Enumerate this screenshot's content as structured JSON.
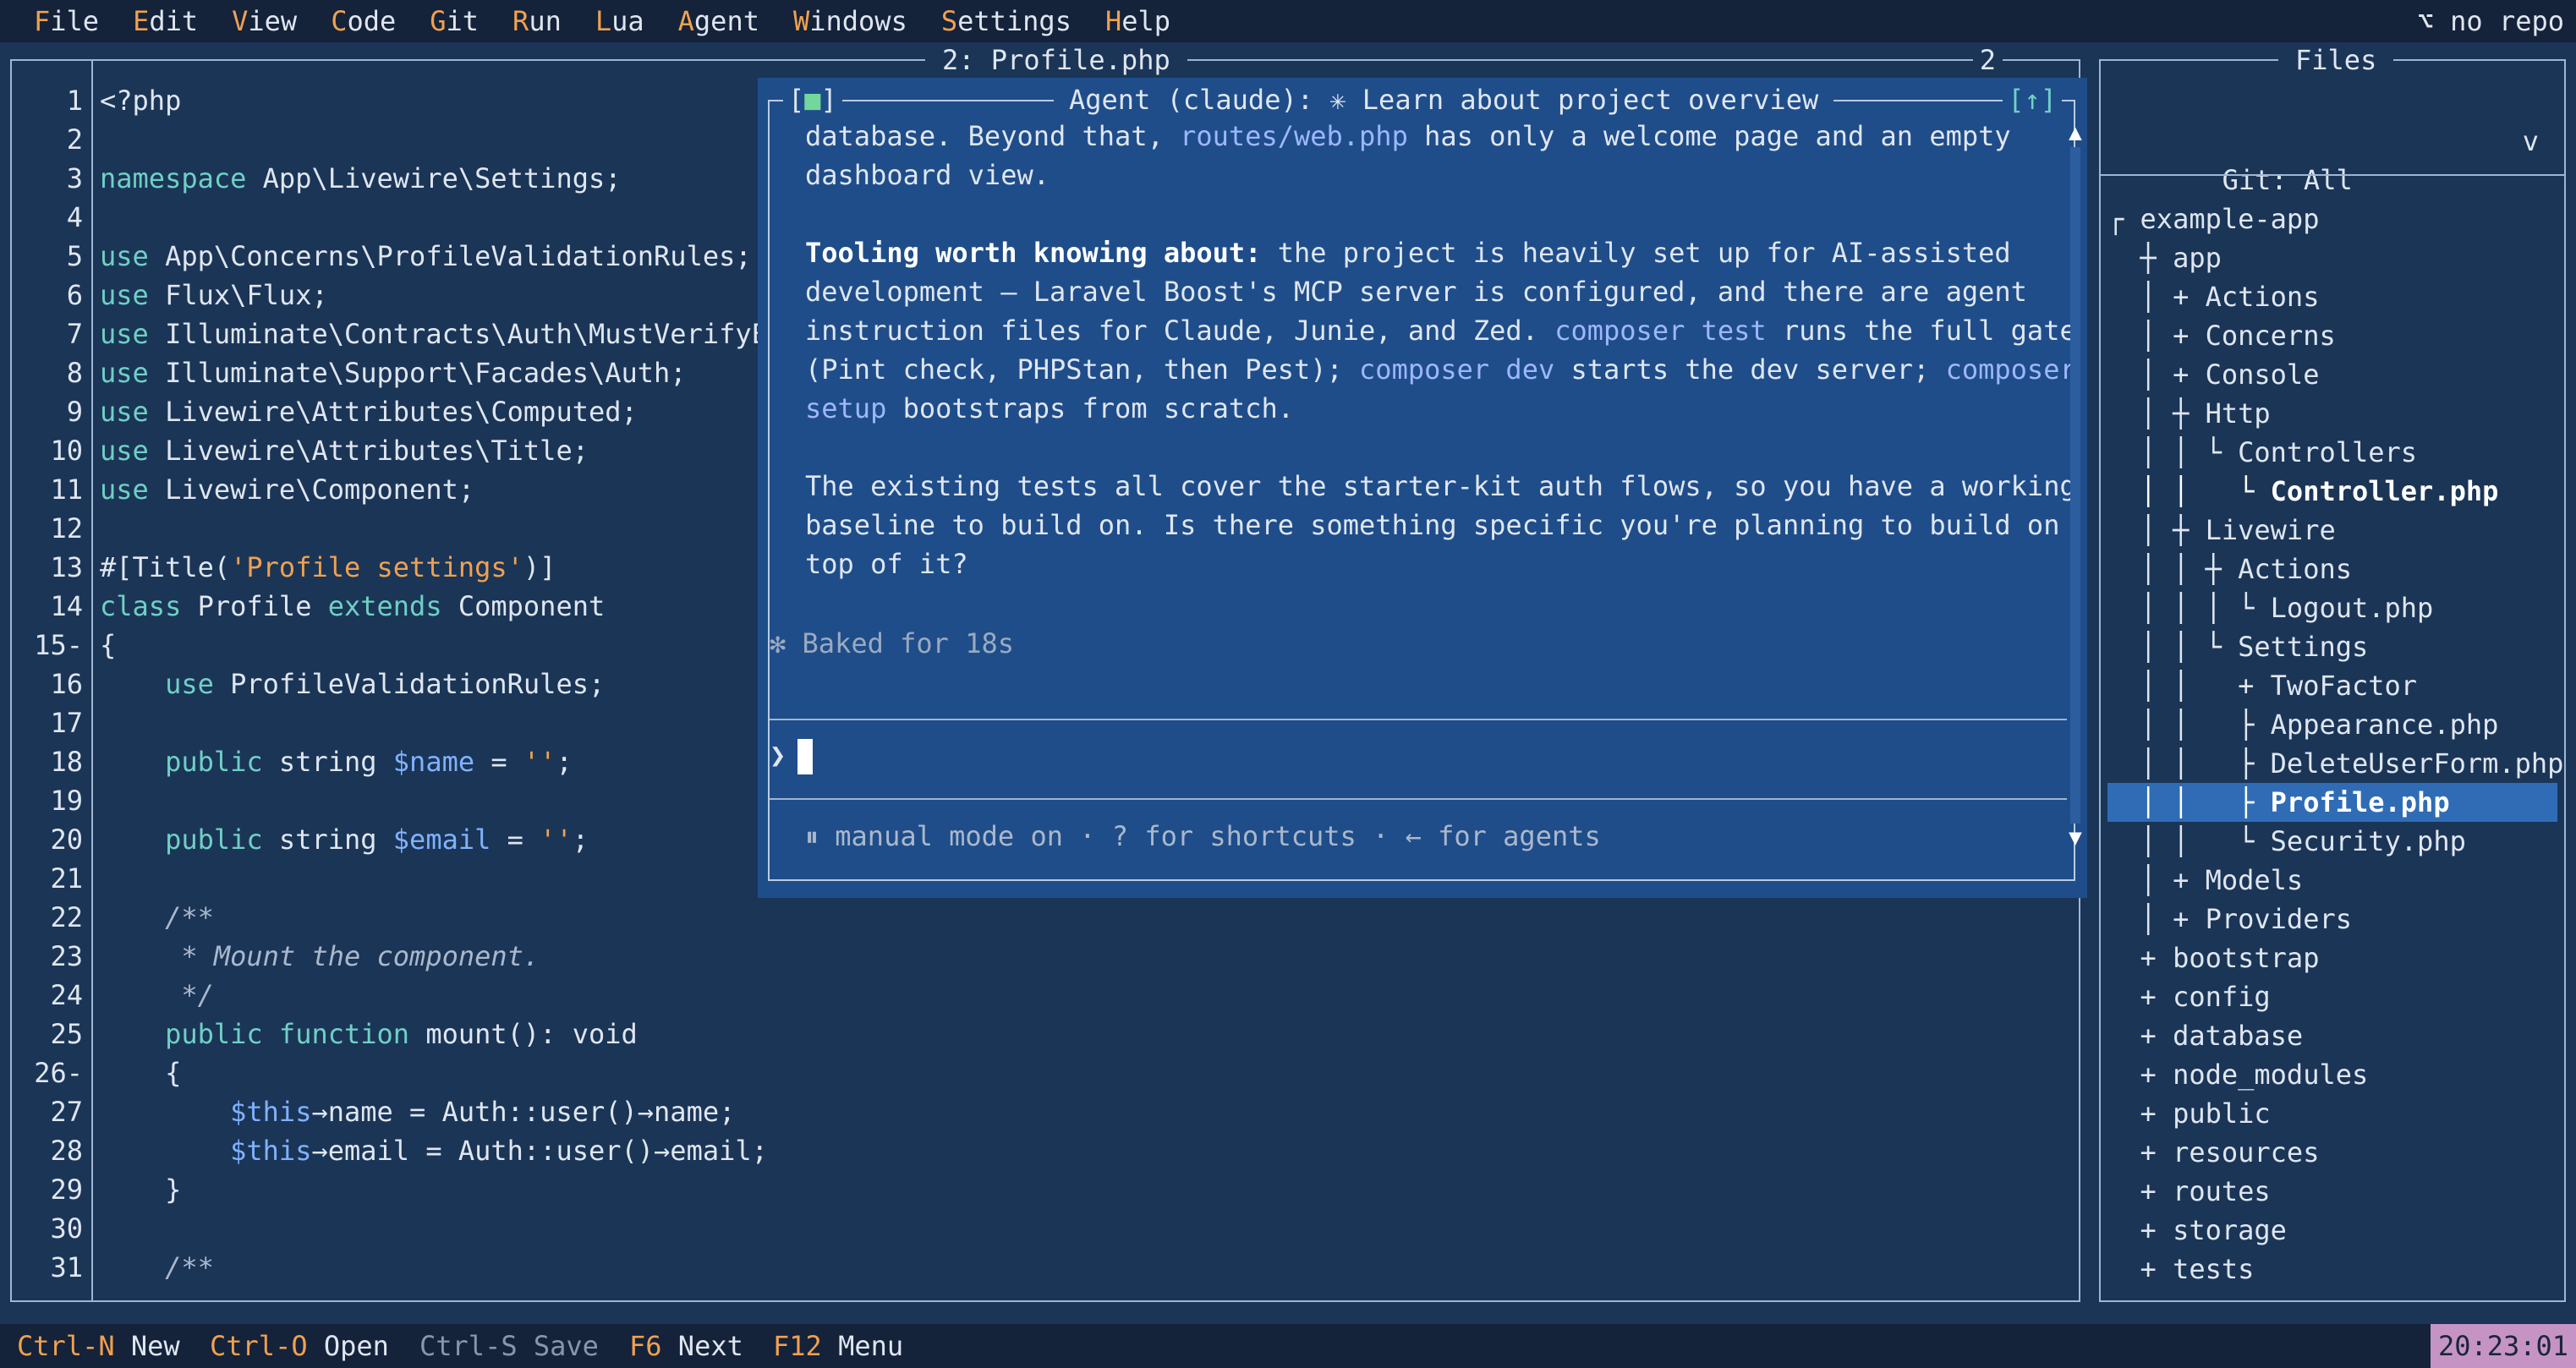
{
  "menubar": {
    "items": [
      {
        "hk": "F",
        "rest": "ile"
      },
      {
        "hk": "E",
        "rest": "dit"
      },
      {
        "hk": "V",
        "rest": "iew"
      },
      {
        "hk": "C",
        "rest": "ode"
      },
      {
        "hk": "G",
        "rest": "it"
      },
      {
        "hk": "R",
        "rest": "un"
      },
      {
        "hk": "L",
        "rest": "ua"
      },
      {
        "hk": "A",
        "rest": "gent"
      },
      {
        "hk": "W",
        "rest": "indows"
      },
      {
        "hk": "S",
        "rest": "ettings"
      },
      {
        "hk": "H",
        "rest": "elp"
      }
    ],
    "repo": "⌥ no repo"
  },
  "editor": {
    "title": "2: Profile.php",
    "tab_count": "2",
    "line_numbers": [
      "1",
      "2",
      "3",
      "4",
      "5",
      "6",
      "7",
      "8",
      "9",
      "10",
      "11",
      "12",
      "13",
      "14",
      "15-",
      "16",
      "17",
      "18",
      "19",
      "20",
      "21",
      "22",
      "23",
      "24",
      "25",
      "26-",
      "27",
      "28",
      "29",
      "30",
      "31"
    ],
    "lines": [
      [
        {
          "t": "<?php"
        }
      ],
      [],
      [
        {
          "t": "namespace",
          "c": "kw"
        },
        {
          "t": " App\\Livewire\\Settings;"
        }
      ],
      [],
      [
        {
          "t": "use",
          "c": "kw"
        },
        {
          "t": " App\\Concerns\\ProfileValidationRules;"
        }
      ],
      [
        {
          "t": "use",
          "c": "kw"
        },
        {
          "t": " Flux\\Flux;"
        }
      ],
      [
        {
          "t": "use",
          "c": "kw"
        },
        {
          "t": " Illuminate\\Contracts\\Auth\\MustVerifyE"
        }
      ],
      [
        {
          "t": "use",
          "c": "kw"
        },
        {
          "t": " Illuminate\\Support\\Facades\\Auth;"
        }
      ],
      [
        {
          "t": "use",
          "c": "kw"
        },
        {
          "t": " Livewire\\Attributes\\Computed;"
        }
      ],
      [
        {
          "t": "use",
          "c": "kw"
        },
        {
          "t": " Livewire\\Attributes\\Title;"
        }
      ],
      [
        {
          "t": "use",
          "c": "kw"
        },
        {
          "t": " Livewire\\Component;"
        }
      ],
      [],
      [
        {
          "t": "#[Title("
        },
        {
          "t": "'Profile settings'",
          "c": "str"
        },
        {
          "t": ")]"
        }
      ],
      [
        {
          "t": "class",
          "c": "kw"
        },
        {
          "t": " Profile "
        },
        {
          "t": "extends",
          "c": "kw"
        },
        {
          "t": " Component"
        }
      ],
      [
        {
          "t": "{"
        }
      ],
      [
        {
          "t": "    "
        },
        {
          "t": "use",
          "c": "kw"
        },
        {
          "t": " ProfileValidationRules;"
        }
      ],
      [],
      [
        {
          "t": "    "
        },
        {
          "t": "public",
          "c": "kw"
        },
        {
          "t": " string "
        },
        {
          "t": "$name",
          "c": "var"
        },
        {
          "t": " = "
        },
        {
          "t": "''",
          "c": "str"
        },
        {
          "t": ";"
        }
      ],
      [],
      [
        {
          "t": "    "
        },
        {
          "t": "public",
          "c": "kw"
        },
        {
          "t": " string "
        },
        {
          "t": "$email",
          "c": "var"
        },
        {
          "t": " = "
        },
        {
          "t": "''",
          "c": "str"
        },
        {
          "t": ";"
        }
      ],
      [],
      [
        {
          "t": "    /**",
          "c": "cm"
        }
      ],
      [
        {
          "t": "     * Mount the component.",
          "c": "cm"
        }
      ],
      [
        {
          "t": "     */",
          "c": "cm"
        }
      ],
      [
        {
          "t": "    "
        },
        {
          "t": "public",
          "c": "kw"
        },
        {
          "t": " "
        },
        {
          "t": "function",
          "c": "kw"
        },
        {
          "t": " mount(): void"
        }
      ],
      [
        {
          "t": "    {"
        }
      ],
      [
        {
          "t": "        "
        },
        {
          "t": "$this",
          "c": "var"
        },
        {
          "t": "→name = Auth::user()→name;"
        }
      ],
      [
        {
          "t": "        "
        },
        {
          "t": "$this",
          "c": "var"
        },
        {
          "t": "→email = Auth::user()→email;"
        }
      ],
      [
        {
          "t": "    }"
        }
      ],
      [],
      [
        {
          "t": "    /**",
          "c": "cm"
        }
      ]
    ]
  },
  "agent": {
    "bracket_open": "[",
    "bracket_square": "■",
    "bracket_close": "]",
    "title": "Agent (claude): ✳ Learn about project overview",
    "scroll_up": "[↑]",
    "body": [
      [
        {
          "t": "database. Beyond that, "
        },
        {
          "t": "routes/web.php",
          "c": "lk"
        },
        {
          "t": " has only a welcome page and an empty"
        }
      ],
      [
        {
          "t": "dashboard view."
        }
      ],
      [],
      [
        {
          "t": "Tooling worth knowing about:",
          "c": "b"
        },
        {
          "t": " the project is heavily set up for AI-assisted"
        }
      ],
      [
        {
          "t": "development — Laravel Boost's MCP server is configured, and there are agent"
        }
      ],
      [
        {
          "t": "instruction files for Claude, Junie, and Zed. "
        },
        {
          "t": "composer test",
          "c": "lk"
        },
        {
          "t": " runs the full gate"
        }
      ],
      [
        {
          "t": "(Pint check, PHPStan, then Pest); "
        },
        {
          "t": "composer dev",
          "c": "lk"
        },
        {
          "t": " starts the dev server; "
        },
        {
          "t": "composer",
          "c": "lk"
        }
      ],
      [
        {
          "t": "setup",
          "c": "lk"
        },
        {
          "t": " bootstraps from scratch."
        }
      ],
      [],
      [
        {
          "t": "The existing tests all cover the starter-kit auth flows, so you have a working"
        }
      ],
      [
        {
          "t": "baseline to build on. Is there something specific you're planning to build on"
        }
      ],
      [
        {
          "t": "top of it?"
        }
      ]
    ],
    "baked": "✻ Baked for 18s",
    "prompt_symbol": "❯",
    "mode_text": "⏸ manual mode on · ? for shortcuts · ← for agents",
    "scroll_up_arrow": "▲",
    "scroll_down_arrow": "▼"
  },
  "files": {
    "title": "Files",
    "git_filter": "Git: All",
    "git_chevron": "v",
    "tree": [
      {
        "t": "┌ example-app"
      },
      {
        "t": "  ┼ app"
      },
      {
        "t": "  │ + Actions"
      },
      {
        "t": "  │ + Concerns"
      },
      {
        "t": "  │ + Console"
      },
      {
        "t": "  │ ┼ Http"
      },
      {
        "t": "  │ │ └ Controllers"
      },
      {
        "t": "  │ │   └ Controller.php",
        "s": "bold"
      },
      {
        "t": "  │ ┼ Livewire"
      },
      {
        "t": "  │ │ ┼ Actions"
      },
      {
        "t": "  │ │ │ └ Logout.php"
      },
      {
        "t": "  │ │ └ Settings"
      },
      {
        "t": "  │ │   + TwoFactor"
      },
      {
        "t": "  │ │   ├ Appearance.php"
      },
      {
        "t": "  │ │   ├ DeleteUserForm.php"
      },
      {
        "t": "  │ │   ├ Profile.php",
        "s": "sel"
      },
      {
        "t": "  │ │   └ Security.php"
      },
      {
        "t": "  │ + Models"
      },
      {
        "t": "  │ + Providers"
      },
      {
        "t": "  + bootstrap"
      },
      {
        "t": "  + config"
      },
      {
        "t": "  + database"
      },
      {
        "t": "  + node_modules"
      },
      {
        "t": "  + public"
      },
      {
        "t": "  + resources"
      },
      {
        "t": "  + routes"
      },
      {
        "t": "  + storage"
      },
      {
        "t": "  + tests"
      }
    ]
  },
  "statusbar": {
    "items": [
      {
        "key": "Ctrl-N",
        "label": "New",
        "dim": false
      },
      {
        "key": "Ctrl-O",
        "label": "Open",
        "dim": false
      },
      {
        "key": "Ctrl-S",
        "label": "Save",
        "dim": true
      },
      {
        "key": "F6",
        "label": "Next",
        "dim": false
      },
      {
        "key": "F12",
        "label": "Menu",
        "dim": false
      }
    ],
    "clock": "20:23:01"
  }
}
